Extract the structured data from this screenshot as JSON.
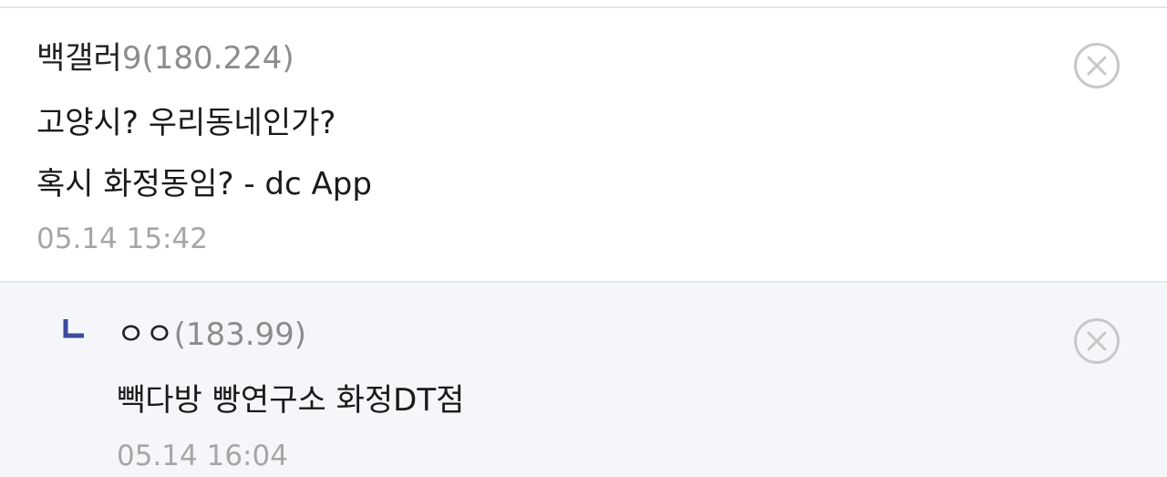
{
  "comments": [
    {
      "author": "백갤러",
      "author_suffix": "9",
      "ip": "(180.224)",
      "lines": [
        "고양시? 우리동네인가?",
        "혹시 화정동임? - dc App"
      ],
      "timestamp": "05.14 15:42",
      "delete_icon": "close-circle-icon"
    }
  ],
  "replies": [
    {
      "reply_marker_icon": "reply-corner-icon",
      "author": "ㅇㅇ",
      "ip": "(183.99)",
      "lines": [
        "빽다방 빵연구소 화정DT점"
      ],
      "timestamp": "05.14 16:04",
      "delete_icon": "close-circle-icon"
    }
  ],
  "colors": {
    "reply_marker": "#3b4a9a",
    "reply_background": "#f5f6f9",
    "divider": "#e3e6ec",
    "ip_text": "#8c8c8c",
    "timestamp_text": "#a6a6a6"
  }
}
